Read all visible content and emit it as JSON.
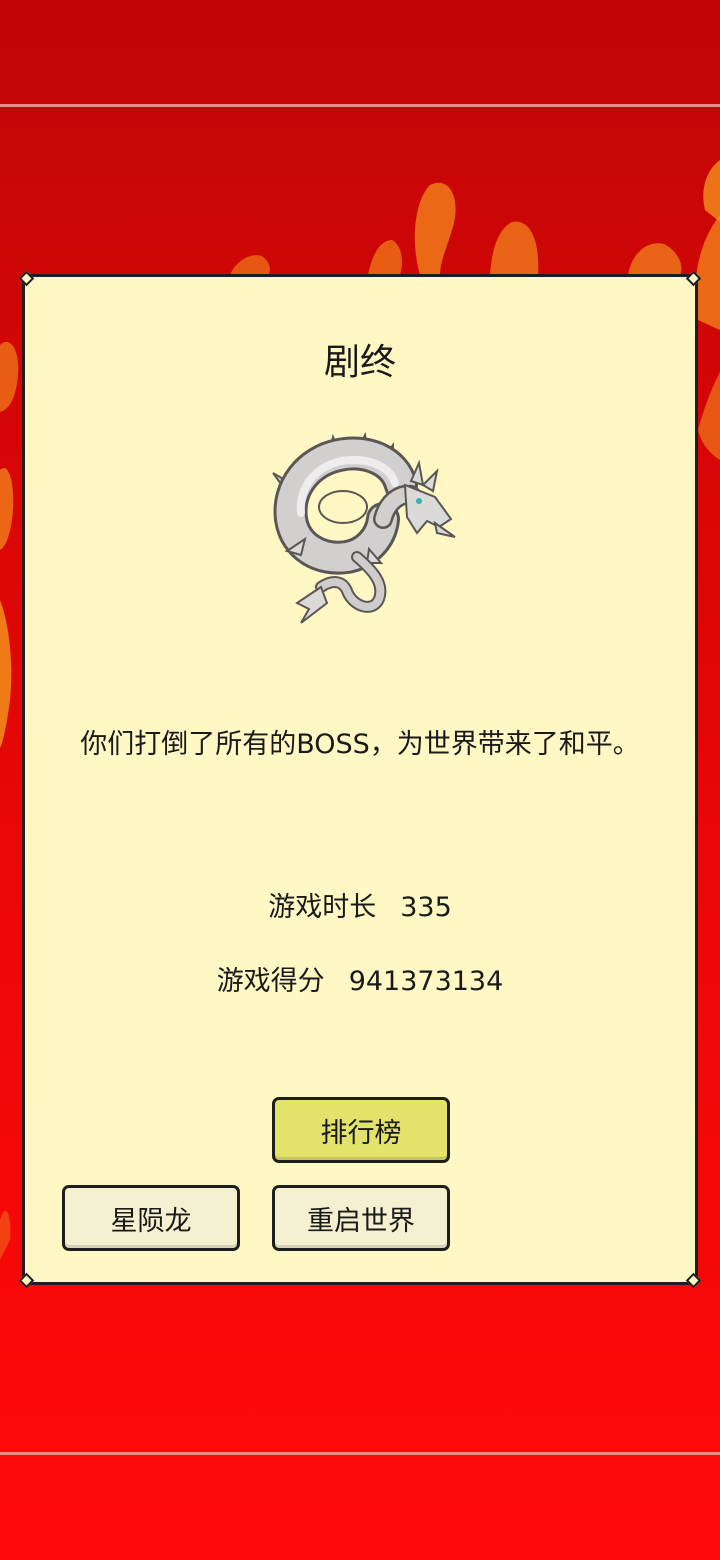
{
  "dialog": {
    "title": "剧终",
    "message": "你们打倒了所有的BOSS，为世界带来了和平。",
    "stats": {
      "time_label": "游戏时长",
      "time_value": "335",
      "score_label": "游戏得分",
      "score_value": "941373134"
    },
    "buttons": {
      "leaderboard": "排行榜",
      "dragon": "星陨龙",
      "restart": "重启世界"
    }
  },
  "colors": {
    "background": "#e00606",
    "panel": "#fff8c4",
    "primary_button": "#e3e26a",
    "secondary_button": "#f3f1cf",
    "border": "#1e1e1e"
  },
  "icons": {
    "boss": "white-dragon-icon"
  }
}
